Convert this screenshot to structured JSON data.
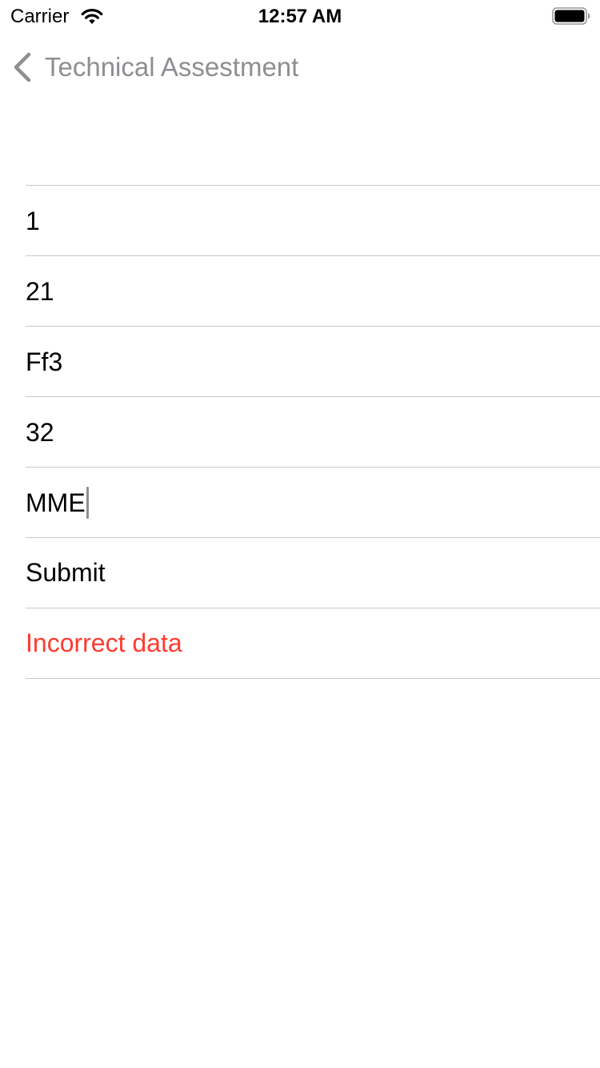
{
  "status_bar": {
    "carrier": "Carrier",
    "time": "12:57 AM"
  },
  "nav": {
    "back_label": "Technical Assestment"
  },
  "form": {
    "fields": [
      {
        "value": "1"
      },
      {
        "value": "21"
      },
      {
        "value": "Ff3"
      },
      {
        "value": "32"
      },
      {
        "value": "MME"
      }
    ],
    "submit_label": "Submit",
    "error_text": "Incorrect data"
  },
  "colors": {
    "error": "#ff3b30",
    "back_tint": "#8e8e93",
    "separator": "#c8c7cc"
  },
  "icons": {
    "wifi": "wifi-icon",
    "battery": "battery-icon",
    "back": "chevron-left-icon"
  }
}
